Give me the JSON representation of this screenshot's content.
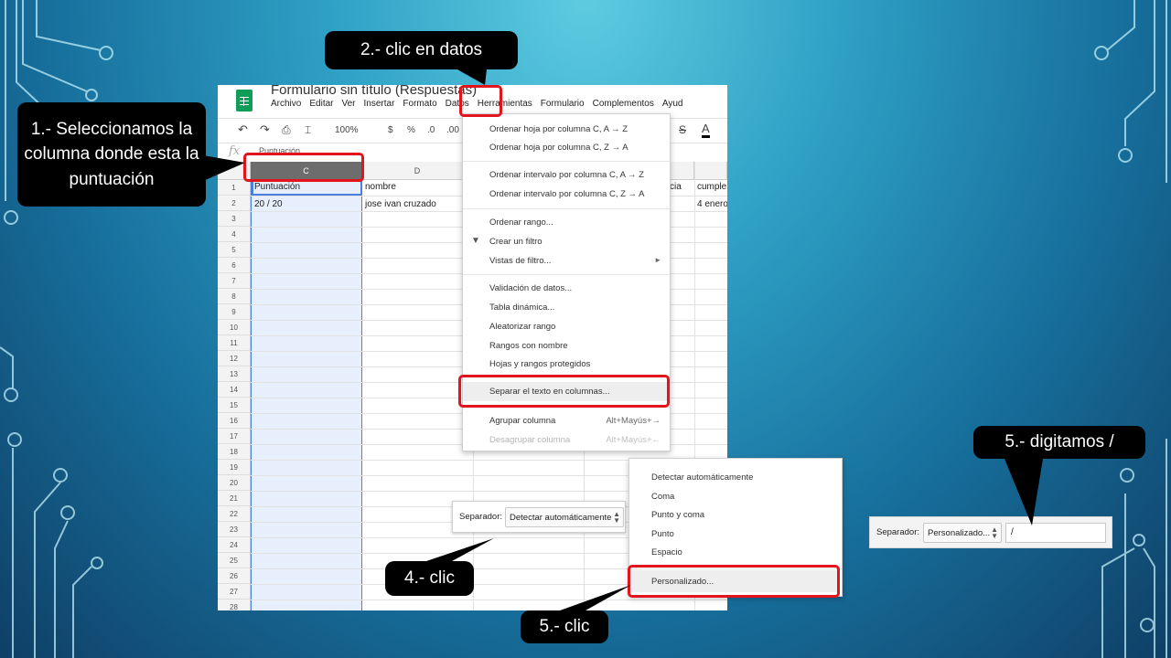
{
  "sheet": {
    "doc_title": "Formulario sin título (Respuestas)",
    "menu": [
      "Archivo",
      "Editar",
      "Ver",
      "Insertar",
      "Formato",
      "Datos",
      "Herramientas",
      "Formulario",
      "Complementos",
      "Ayud"
    ],
    "toolbar": {
      "zoom": "100%",
      "currency": "$",
      "percent": "%",
      "dec_less": ".0",
      "dec_more": ".00",
      "strike": "S",
      "text_color": "A"
    },
    "formula": {
      "fx": "fx",
      "value": "Puntuación"
    },
    "columns": {
      "c": "C",
      "d": "D"
    },
    "rows": [
      "1",
      "2",
      "3",
      "4",
      "5",
      "6",
      "7",
      "8",
      "9",
      "10",
      "11",
      "12",
      "13",
      "14",
      "15",
      "16",
      "17",
      "18",
      "19",
      "20",
      "21",
      "22",
      "23",
      "24",
      "25",
      "26",
      "27",
      "28"
    ],
    "cells": {
      "c1": "Puntuación",
      "d1": "nombre",
      "g1": "cia",
      "h1": "cumple",
      "c2": "20 / 20",
      "d2": "jose ivan cruzado",
      "h2": "4 enero"
    }
  },
  "datos_menu": {
    "items": [
      "Ordenar hoja por columna C, A → Z",
      "Ordenar hoja por columna C, Z → A",
      "Ordenar intervalo por columna C, A → Z",
      "Ordenar intervalo por columna C, Z → A",
      "Ordenar rango...",
      "Crear un filtro",
      "Vistas de filtro...",
      "Validación de datos...",
      "Tabla dinámica...",
      "Aleatorizar rango",
      "Rangos con nombre",
      "Hojas y rangos protegidos",
      "Separar el texto en columnas...",
      "Agrupar columna",
      "Desagrupar columna"
    ],
    "shortcuts": {
      "group": "Alt+Mayús+→",
      "ungroup": "Alt+Mayús+←"
    }
  },
  "separator_panel": {
    "label": "Separador:",
    "value": "Detectar automáticamente"
  },
  "separator_options": [
    "Detectar automáticamente",
    "Coma",
    "Punto y coma",
    "Punto",
    "Espacio",
    "Personalizado..."
  ],
  "separator_custom": {
    "label": "Separador:",
    "value": "Personalizado...",
    "input": "/"
  },
  "callouts": {
    "step1": "1.- Seleccionamos la columna donde esta la puntuación",
    "step2": "2.- clic en datos",
    "step4": "4.- clic",
    "step5a": "5.- clic",
    "step5b": "5.- digitamos /"
  },
  "colors": {
    "highlight": "#e3141b",
    "callout_bg": "#000000",
    "sheets_green": "#0f9d58"
  }
}
